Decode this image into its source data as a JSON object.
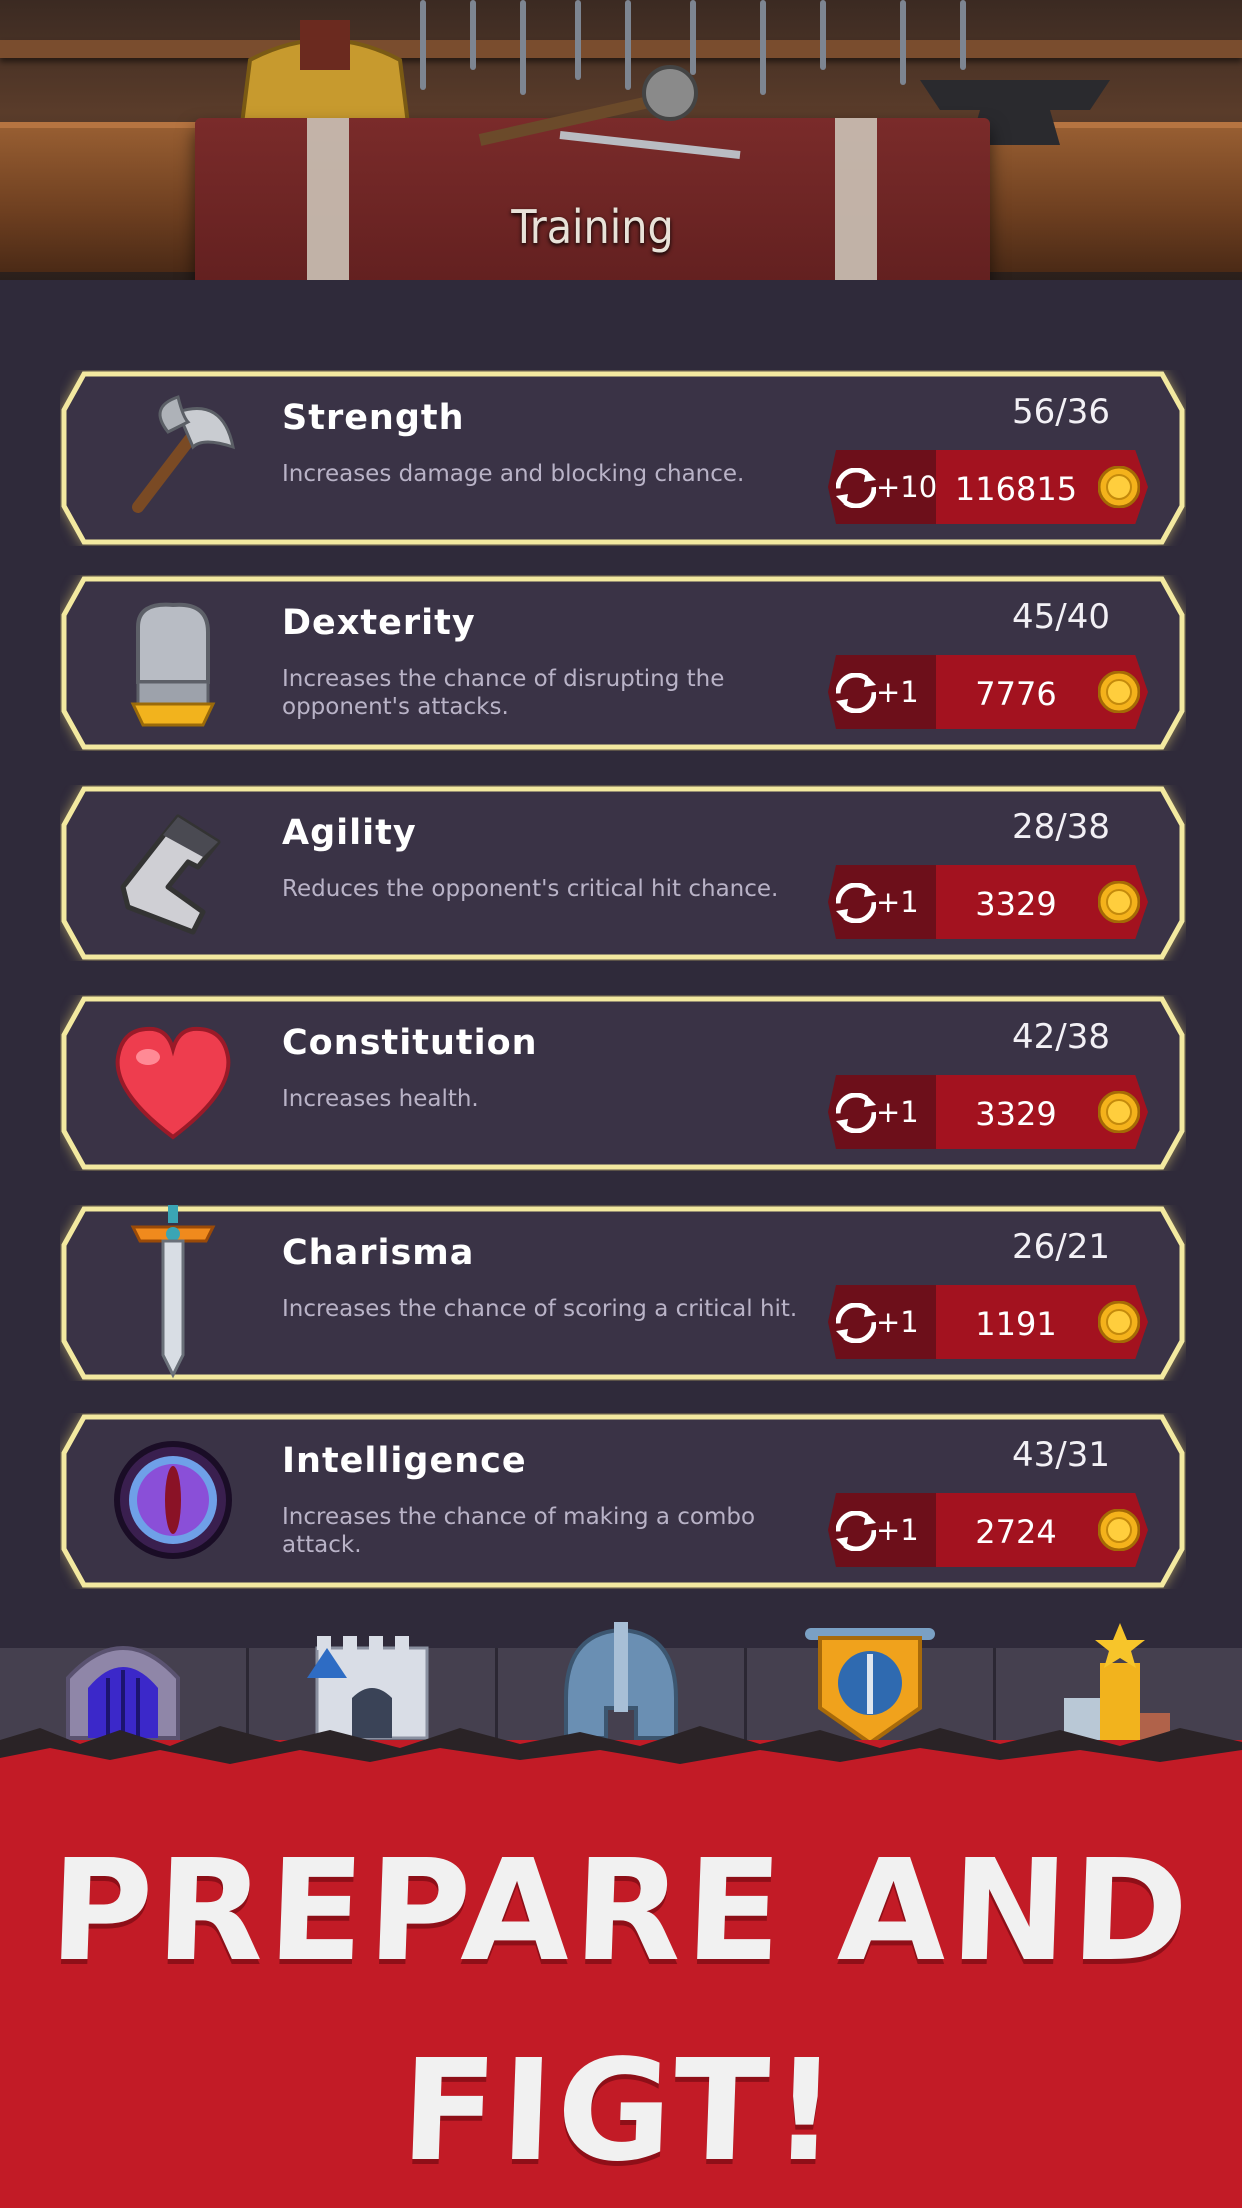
{
  "header": {
    "title": "Training"
  },
  "stats": [
    {
      "name": "Strength",
      "description": "Increases damage and blocking chance.",
      "level": "56/36",
      "increment": "+10",
      "cost": "116815",
      "icon": "axe-icon"
    },
    {
      "name": "Dexterity",
      "description": "Increases the chance of disrupting the opponent's attacks.",
      "level": "45/40",
      "increment": "+1",
      "cost": "7776",
      "icon": "gauntlet-icon"
    },
    {
      "name": "Agility",
      "description": "Reduces the opponent's critical hit chance.",
      "level": "28/38",
      "increment": "+1",
      "cost": "3329",
      "icon": "boot-icon"
    },
    {
      "name": "Constitution",
      "description": "Increases health.",
      "level": "42/38",
      "increment": "+1",
      "cost": "3329",
      "icon": "heart-icon"
    },
    {
      "name": "Charisma",
      "description": "Increases the chance of scoring a critical hit.",
      "level": "26/21",
      "increment": "+1",
      "cost": "1191",
      "icon": "sword-icon"
    },
    {
      "name": "Intelligence",
      "description": "Increases the chance of making a combo attack.",
      "level": "43/31",
      "increment": "+1",
      "cost": "2724",
      "icon": "eye-icon"
    }
  ],
  "nav": {
    "tabs": [
      {
        "icon": "dungeon-gate-icon"
      },
      {
        "icon": "castle-icon"
      },
      {
        "icon": "helmet-icon"
      },
      {
        "icon": "shield-banner-icon"
      },
      {
        "icon": "leaderboard-icon"
      }
    ]
  },
  "promo": {
    "line1": "PREPARE AND",
    "line2": "FIGT!"
  },
  "colors": {
    "card_bg": "#3a3346",
    "card_border": "#f3e9a0",
    "cost_bg": "#a3121f",
    "promo_bg": "#c21b26"
  }
}
